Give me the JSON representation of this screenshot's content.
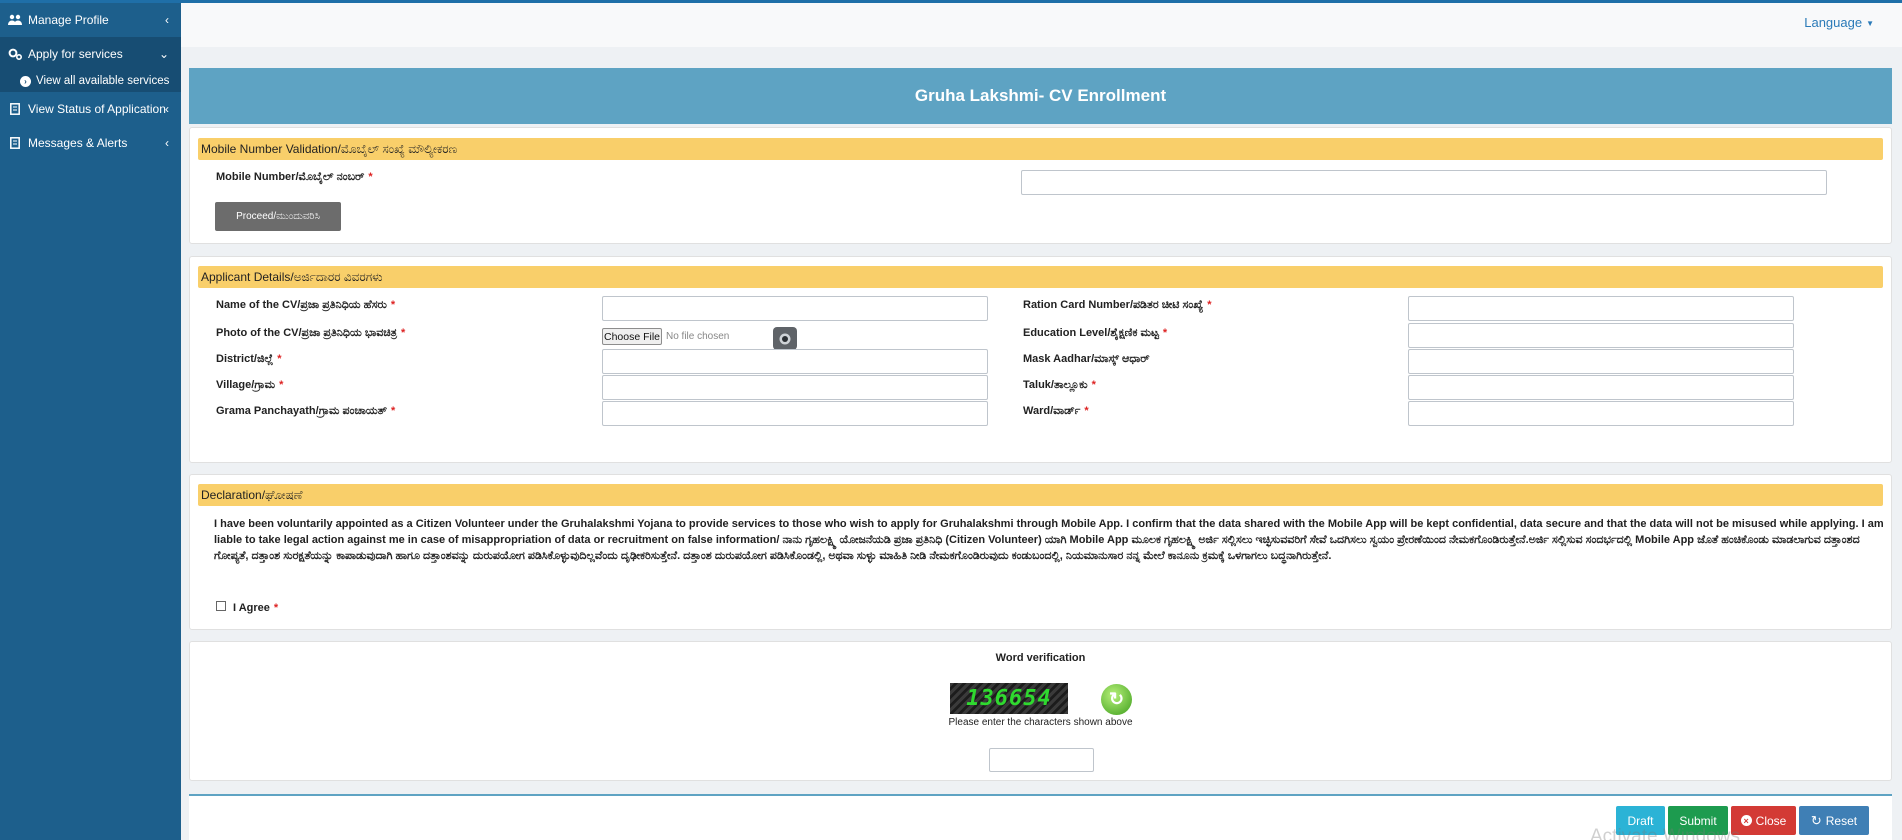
{
  "sidebar": {
    "items": [
      {
        "label": "Manage Profile",
        "icon": "users-icon"
      },
      {
        "label": "Apply for services",
        "icon": "cogs-icon"
      },
      {
        "label": "View Status of Application",
        "icon": "doc-icon"
      },
      {
        "label": "Messages & Alerts",
        "icon": "doc-icon"
      }
    ],
    "sub_item": "View all available services"
  },
  "header": {
    "language": "Language"
  },
  "page_title": "Gruha Lakshmi- CV Enrollment",
  "mobile_section": {
    "heading": "Mobile Number Validation/ಮೊಬೈಲ್ ಸಂಖ್ಯೆ ಮೌಲ್ಯೀಕರಣ",
    "mobile_label": "Mobile Number/ಮೊಬೈಲ್ ನಂಬರ್",
    "proceed": "Proceed/ಮುಂದುವರಿಸಿ"
  },
  "applicant_section": {
    "heading": "Applicant Details/ಅರ್ಜಿದಾರರ ವಿವರಗಳು",
    "name": "Name of the CV/ಪ್ರಜಾ ಪ್ರತಿನಿಧಿಯ ಹೆಸರು",
    "photo": "Photo of the CV/ಪ್ರಜಾ ಪ್ರತಿನಿಧಿಯ ಭಾವಚಿತ್ರ",
    "district": "District/ಜಿಲ್ಲೆ",
    "village": "Village/ಗ್ರಾಮ",
    "gp": "Grama Panchayath/ಗ್ರಾಮ ಪಂಚಾಯತ್",
    "ration": "Ration Card Number/ಪಡಿತರ ಚೀಟಿ ಸಂಖ್ಯೆ",
    "education": "Education Level/ಶೈಕ್ಷಣಿಕ ಮಟ್ಟ",
    "aadhar": "Mask Aadhar/ಮಾಸ್ಕ್ ಆಧಾರ್",
    "taluk": "Taluk/ತಾಲ್ಲೂಕು",
    "ward": "Ward/ವಾರ್ಡ್",
    "choose_file": "Choose File",
    "no_file": "No file chosen"
  },
  "declaration": {
    "heading": "Declaration/ಘೋಷಣೆ",
    "text": "I have been voluntarily appointed as a Citizen Volunteer under the Gruhalakshmi Yojana to provide services to those who wish to apply for Gruhalakshmi through Mobile App. I confirm that the data shared with the Mobile App will be kept confidential, data secure and that the data will not be misused while applying. I am liable to take legal action against me in case of misappropriation of data or recruitment on false information/ ನಾನು ಗೃಹಲಕ್ಷ್ಮಿ ಯೋಜನೆಯಡಿ ಪ್ರಜಾ ಪ್ರತಿನಿಧಿ (Citizen Volunteer) ಯಾಗಿ Mobile App ಮೂಲಕ ಗೃಹಲಕ್ಷ್ಮಿ ಅರ್ಜಿ ಸಲ್ಲಿಸಲು ಇಚ್ಛಿಸುವವರಿಗೆ ಸೇವೆ ಒದಗಿಸಲು ಸ್ವಯಂ ಪ್ರೇರಣೆಯಿಂದ ನೇಮಕಗೊಂಡಿರುತ್ತೇನೆ.ಅರ್ಜಿ ಸಲ್ಲಿಸುವ ಸಂದರ್ಭದಲ್ಲಿ Mobile App ಜೊತೆ ಹಂಚಿಕೊಂಡು ಮಾಡಲಾಗುವ ದತ್ತಾಂಶದ ಗೋಪ್ಯತೆ, ದತ್ತಾಂಶ ಸುರಕ್ಷತೆಯನ್ನು ಕಾಪಾಡುವುದಾಗಿ ಹಾಗೂ ದತ್ತಾಂಶವನ್ನು ದುರುಪಯೋಗ ಪಡಿಸಿಕೊಳ್ಳುವುದಿಲ್ಲವೆಂದು ದೃಢೀಕರಿಸುತ್ತೇನೆ. ದತ್ತಾಂಶ ದುರುಪಯೋಗ ಪಡಿಸಿಕೊಂಡಲ್ಲಿ, ಅಥವಾ ಸುಳ್ಳು ಮಾಹಿತಿ ನೀಡಿ ನೇಮಕಗೊಂಡಿರುವುದು ಕಂಡುಬಂದಲ್ಲಿ, ನಿಯಮಾನುಸಾರ ನನ್ನ ಮೇಲೆ ಕಾನೂನು ಕ್ರಮಕ್ಕೆ ಒಳಗಾಗಲು ಬದ್ಧನಾಗಿರುತ್ತೇನೆ.",
    "agree": "I Agree"
  },
  "verification": {
    "title": "Word verification",
    "captcha": "136654",
    "hint": "Please enter the characters shown above"
  },
  "footer": {
    "draft": "Draft",
    "submit": "Submit",
    "close": "Close",
    "reset": "Reset"
  },
  "watermark": "Activate Windows",
  "colors": {
    "sidebar": "#1d5f8c",
    "title_bar": "#5ea3c3",
    "section_head": "#f9cf6a",
    "draft": "#2bb3d6",
    "submit": "#1d9b4f",
    "close": "#d33a35",
    "reset": "#3f7fb5"
  }
}
